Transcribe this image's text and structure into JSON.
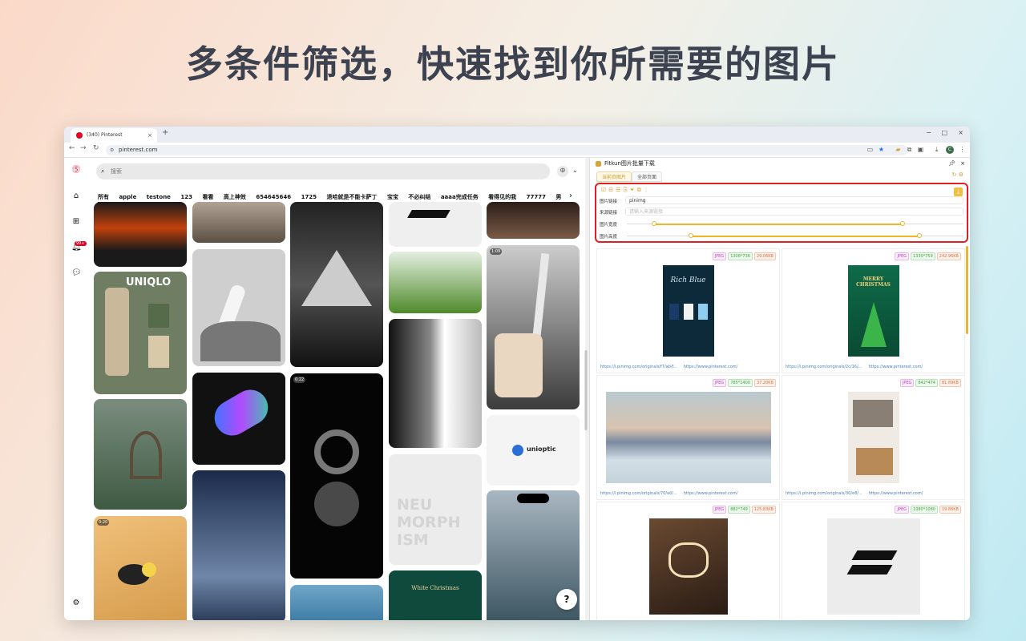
{
  "headline": "多条件筛选，快速找到你所需要的图片",
  "browser": {
    "tab_title": "(340) Pinterest",
    "tab_close": "×",
    "new_tab": "+",
    "url": "pinterest.com",
    "window_controls": [
      "−",
      "□",
      "×"
    ],
    "profile_initial": "C"
  },
  "pinterest": {
    "search_placeholder": "搜索",
    "lang_badge": "中",
    "notifications_badge": "99+",
    "boards": [
      "所有",
      "apple",
      "testone",
      "123",
      "看看",
      "高上神效",
      "654645646",
      "1725",
      "退哈就是不能卡萨丁",
      "宝宝",
      "不必纠结",
      "aaaa完成任务",
      "看得见的我",
      "77777",
      "男"
    ],
    "pins": {
      "uniqlo": "UNIQLO",
      "time_a": "0:20",
      "time_b": "0:22",
      "time_c": "1:09",
      "unioptic": "unioptic",
      "neu": "NEU\nMORPH\nISM",
      "white_christmas": "White Christmas"
    },
    "help": "?"
  },
  "extension": {
    "title": "Fitkun图片批量下载",
    "tabs": [
      "当前页图片",
      "全部页面"
    ],
    "filter": {
      "link_label": "图片链接",
      "link_value": "pinimg",
      "source_label": "来源链接",
      "source_placeholder": "请输入来源链接",
      "width_label": "图片宽度",
      "height_label": "图片高度",
      "width_range": [
        0.08,
        0.82
      ],
      "height_range": [
        0.19,
        0.87
      ]
    },
    "images": [
      {
        "format": "JPEG",
        "dims": "1308*736",
        "size": "29.06KB",
        "src": "https://i.pinimg.com/originals/f7/ab/f...",
        "page": "https://www.pinterest.com/",
        "art": "Rich Blue"
      },
      {
        "format": "JPEG",
        "dims": "1330*759",
        "size": "242.96KB",
        "src": "https://i.pinimg.com/originals/2c/16/...",
        "page": "https://www.pinterest.com/",
        "art": "MERRY CHRISTMAS"
      },
      {
        "format": "JPEG",
        "dims": "785*1400",
        "size": "37.20KB",
        "src": "https://i.pinimg.com/originals/70/a0/...",
        "page": "https://www.pinterest.com/",
        "art": ""
      },
      {
        "format": "JPEG",
        "dims": "842*474",
        "size": "81.89KB",
        "src": "https://i.pinimg.com/originals/30/e8/...",
        "page": "https://www.pinterest.com/",
        "art": ""
      },
      {
        "format": "JPEG",
        "dims": "882*749",
        "size": "125.83KB",
        "src": "",
        "page": "",
        "art": ""
      },
      {
        "format": "JPEG",
        "dims": "1080*1080",
        "size": "19.86KB",
        "src": "",
        "page": "",
        "art": ""
      }
    ]
  }
}
